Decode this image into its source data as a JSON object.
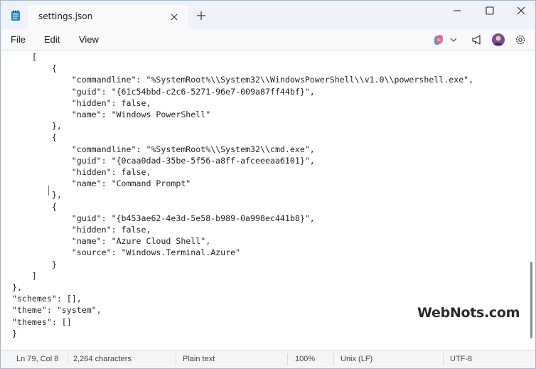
{
  "tab": {
    "title": "settings.json"
  },
  "menu": {
    "file": "File",
    "edit": "Edit",
    "view": "View"
  },
  "toolbar": {
    "copilot_icon": "copilot-icon",
    "chevron_icon": "chevron-down-icon",
    "share_icon": "megaphone-icon",
    "avatar_icon": "avatar",
    "settings_icon": "gear-icon"
  },
  "editor": {
    "lines": [
      "    [",
      "        {",
      "            \"commandline\": \"%SystemRoot%\\\\System32\\\\WindowsPowerShell\\\\v1.0\\\\powershell.exe\",",
      "            \"guid\": \"{61c54bbd-c2c6-5271-96e7-009a87ff44bf}\",",
      "            \"hidden\": false,",
      "            \"name\": \"Windows PowerShell\"",
      "        },",
      "        {",
      "            \"commandline\": \"%SystemRoot%\\\\System32\\\\cmd.exe\",",
      "            \"guid\": \"{0caa0dad-35be-5f56-a8ff-afceeeaa6101}\",",
      "            \"hidden\": false,",
      "            \"name\": \"Command Prompt\"",
      "        },",
      "        {",
      "            \"guid\": \"{b453ae62-4e3d-5e58-b989-0a998ec441b8}\",",
      "            \"hidden\": false,",
      "            \"name\": \"Azure Cloud Shell\",",
      "            \"source\": \"Windows.Terminal.Azure\"",
      "        }",
      "    ]",
      "},",
      "\"schemes\": [],",
      "\"theme\": \"system\",",
      "\"themes\": []",
      "}"
    ]
  },
  "watermark": "WebNots.com",
  "status": {
    "position": "Ln 79, Col 8",
    "characters": "2,264 characters",
    "format": "Plain text",
    "zoom": "100%",
    "line_ending": "Unix (LF)",
    "encoding": "UTF-8"
  }
}
